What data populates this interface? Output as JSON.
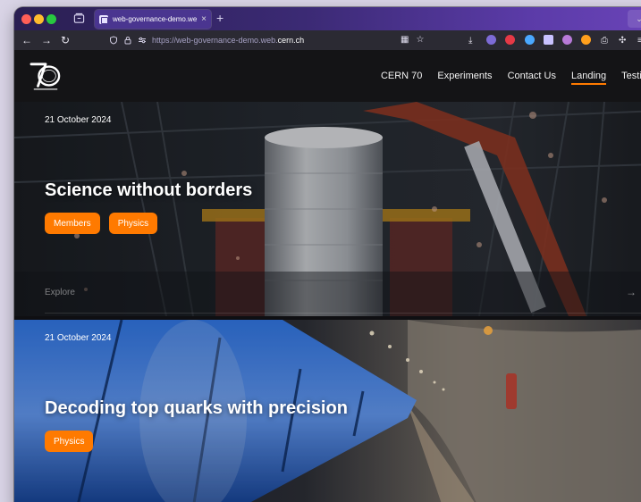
{
  "browser": {
    "tab_title": "web-governance-demo.web.cer",
    "tab_close": "×",
    "new_tab": "+",
    "url_prefix": "https://web-governance-demo.web.",
    "url_domain": "cern.ch",
    "nav_back": "←",
    "nav_forward": "→",
    "nav_reload": "↻"
  },
  "site": {
    "logo_alt": "CERN 70",
    "menu": [
      {
        "label": "CERN 70"
      },
      {
        "label": "Experiments"
      },
      {
        "label": "Contact Us"
      },
      {
        "label": "Landing"
      },
      {
        "label": "Testing"
      }
    ],
    "active_menu": "Landing",
    "accent_color": "#ff7a00"
  },
  "articles": [
    {
      "date": "21 October 2024",
      "title": "Science without borders",
      "tags": [
        "Members",
        "Physics"
      ],
      "explore_label": "Explore",
      "arrow": "→"
    },
    {
      "date": "21 October 2024",
      "title": "Decoding top quarks with precision",
      "tags": [
        "Physics"
      ]
    }
  ]
}
